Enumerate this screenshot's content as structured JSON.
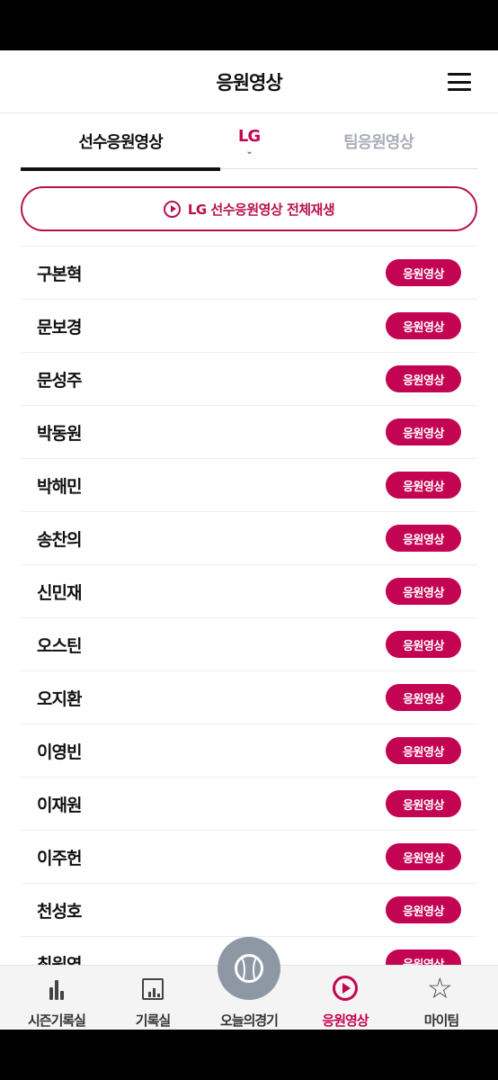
{
  "header": {
    "title": "응원영상"
  },
  "tabs": {
    "player": "선수응원영상",
    "team_select": "LG",
    "team_select_chevron": "⌄",
    "team": "팀응원영상"
  },
  "play_all": {
    "label": "LG 선수응원영상 전체재생"
  },
  "players": [
    {
      "name": "구본혁",
      "button": "응원영상"
    },
    {
      "name": "문보경",
      "button": "응원영상"
    },
    {
      "name": "문성주",
      "button": "응원영상"
    },
    {
      "name": "박동원",
      "button": "응원영상"
    },
    {
      "name": "박해민",
      "button": "응원영상"
    },
    {
      "name": "송찬의",
      "button": "응원영상"
    },
    {
      "name": "신민재",
      "button": "응원영상"
    },
    {
      "name": "오스틴",
      "button": "응원영상"
    },
    {
      "name": "오지환",
      "button": "응원영상"
    },
    {
      "name": "이영빈",
      "button": "응원영상"
    },
    {
      "name": "이재원",
      "button": "응원영상"
    },
    {
      "name": "이주헌",
      "button": "응원영상"
    },
    {
      "name": "천성호",
      "button": "응원영상"
    },
    {
      "name": "최원영",
      "button": "응원영상"
    }
  ],
  "bottom_nav": {
    "season": "시즌기록실",
    "records": "기록실",
    "today": "오늘의경기",
    "cheer": "응원영상",
    "mypage": "마이팀"
  },
  "colors": {
    "accent": "#c30452",
    "inactive_tab": "#a9aeb8",
    "center_button": "#8e98a4"
  }
}
